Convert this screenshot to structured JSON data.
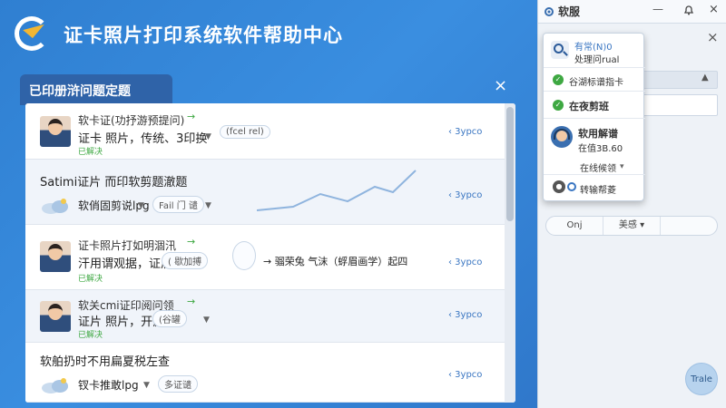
{
  "header": {
    "title": "证卡照片打印系统软件帮助中心"
  },
  "panel": {
    "tab_label": "已印册浒问题定题",
    "close_label": "×"
  },
  "list": [
    {
      "title": "软卡证(功抒游预提问)",
      "sub": "证卡 照片，传统、3印换",
      "status": "已解决",
      "tag": "(fcel rel)",
      "link": "‹ 3ypco"
    },
    {
      "title": "Satimi证片 而印软剪题澈题",
      "sub": "软俏固剪说lpg",
      "tag": "Fail 门 谴",
      "link": "‹ 3ypco"
    },
    {
      "title": "证卡照片打如明涸汛",
      "sub": "汗用谓观据，证盾",
      "status": "已解决",
      "tag": "( 歇加搏",
      "note": "→ 骝荣兔 气沫（蜉眉画学）起四",
      "link": "‹ 3ypco"
    },
    {
      "title": "软关cmi证印阅问领",
      "sub": "证片 照片，开源",
      "status": "已解决",
      "tag": "(谷罐",
      "link": "‹ 3ypco"
    },
    {
      "title": "软舶扔时不用扁夏税左查",
      "sub": "钗卡推敢lpg",
      "tag": "多证谴",
      "link": "‹ 3ypco"
    }
  ],
  "sidebar": {
    "title": "软服",
    "minimize": "—",
    "close": "×",
    "tabs": [
      "Onj",
      "美感 ▾",
      ""
    ],
    "float_button": "Trale"
  },
  "popover": {
    "search_title": "有常(N)0",
    "search_sub": "处理问rual",
    "item1": "谷湖标谱指卡",
    "item2": "在夜剪班",
    "agent_title": "软用解谱",
    "agent_sub": "在值3B.60",
    "status": "在线候领",
    "bottom": "转输帮菱"
  },
  "colors": {
    "accent": "#2f7fd1",
    "panel_tab": "#2f63a8",
    "success": "#3ea842",
    "link": "#3a76c2"
  }
}
